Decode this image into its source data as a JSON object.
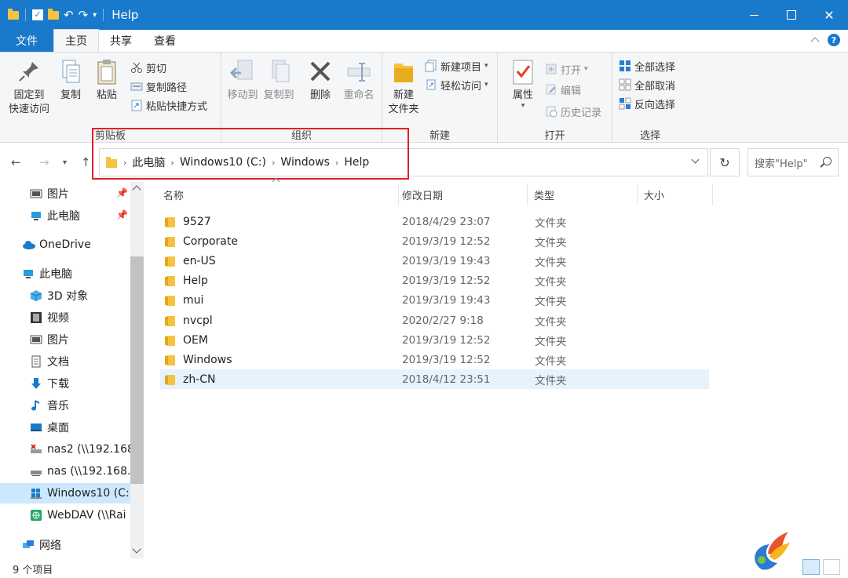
{
  "window": {
    "title": "Help",
    "close_glyph": "✕"
  },
  "tabs": [
    {
      "label": "文件"
    },
    {
      "label": "主页"
    },
    {
      "label": "共享"
    },
    {
      "label": "查看"
    }
  ],
  "help_glyph": "?",
  "ribbon": {
    "clipboard": {
      "label": "剪贴板",
      "pin": "固定到\n快速访问",
      "copy": "复制",
      "paste": "粘贴",
      "cut": "剪切",
      "copy_path": "复制路径",
      "paste_shortcut": "粘贴快捷方式"
    },
    "organize": {
      "label": "组织",
      "move_to": "移动到",
      "copy_to": "复制到",
      "delete": "删除",
      "rename": "重命名"
    },
    "new": {
      "label": "新建",
      "new_folder": "新建\n文件夹",
      "new_item": "新建项目",
      "easy_access": "轻松访问"
    },
    "open": {
      "label": "打开",
      "properties": "属性",
      "open": "打开",
      "edit": "编辑",
      "history": "历史记录"
    },
    "select": {
      "label": "选择",
      "select_all": "全部选择",
      "select_none": "全部取消",
      "invert": "反向选择"
    }
  },
  "address": {
    "crumbs": [
      "此电脑",
      "Windows10 (C:)",
      "Windows",
      "Help"
    ],
    "separator": "›"
  },
  "search": {
    "placeholder": "搜索\"Help\""
  },
  "sidebar": {
    "items": [
      {
        "label": "图片"
      },
      {
        "label": "此电脑"
      },
      {
        "label": "OneDrive"
      },
      {
        "label": "此电脑"
      },
      {
        "label": "3D 对象"
      },
      {
        "label": "视频"
      },
      {
        "label": "图片"
      },
      {
        "label": "文档"
      },
      {
        "label": "下载"
      },
      {
        "label": "音乐"
      },
      {
        "label": "桌面"
      },
      {
        "label": "nas2 (\\\\192.168"
      },
      {
        "label": "nas (\\\\192.168.1"
      },
      {
        "label": "Windows10 (C:"
      },
      {
        "label": "WebDAV (\\\\Rai"
      },
      {
        "label": "网络"
      }
    ]
  },
  "columns": {
    "name": "名称",
    "modified": "修改日期",
    "type": "类型",
    "size": "大小"
  },
  "files": [
    {
      "name": "9527",
      "date": "2018/4/29 23:07",
      "type": "文件夹"
    },
    {
      "name": "Corporate",
      "date": "2019/3/19 12:52",
      "type": "文件夹"
    },
    {
      "name": "en-US",
      "date": "2019/3/19 19:43",
      "type": "文件夹"
    },
    {
      "name": "Help",
      "date": "2019/3/19 12:52",
      "type": "文件夹"
    },
    {
      "name": "mui",
      "date": "2019/3/19 19:43",
      "type": "文件夹"
    },
    {
      "name": "nvcpl",
      "date": "2020/2/27 9:18",
      "type": "文件夹"
    },
    {
      "name": "OEM",
      "date": "2019/3/19 12:52",
      "type": "文件夹"
    },
    {
      "name": "Windows",
      "date": "2019/3/19 12:52",
      "type": "文件夹"
    },
    {
      "name": "zh-CN",
      "date": "2018/4/12 23:51",
      "type": "文件夹"
    }
  ],
  "status": {
    "count": "9 个项目"
  },
  "colors": {
    "accent": "#1979ca",
    "folder": "#f5c342",
    "highlight_box": "#e02028",
    "selection": "#cce8ff"
  }
}
